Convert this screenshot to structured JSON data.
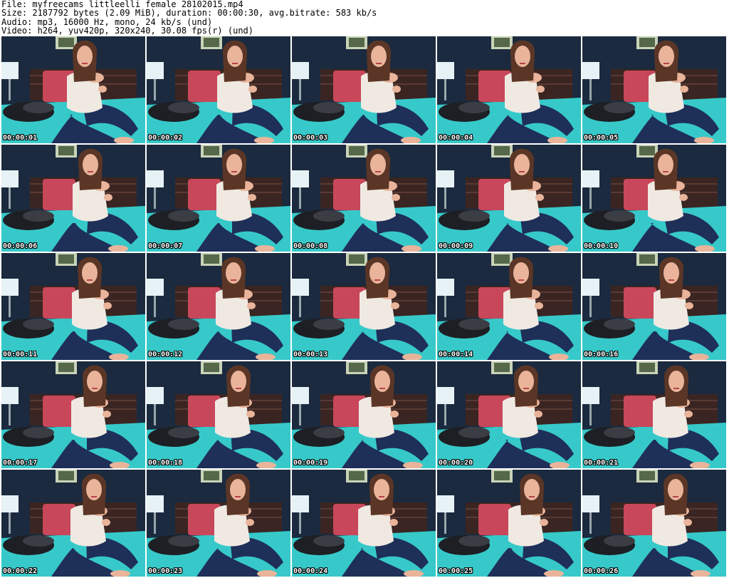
{
  "header": {
    "file_line": "File: myfreecams_littleelli_female_28102015.mp4",
    "size_line": "Size: 2187792 bytes (2.09 MiB), duration: 00:00:30, avg.bitrate: 583 kb/s",
    "audio_line": "Audio: mp3, 16000 Hz, mono, 24 kb/s (und)",
    "video_line": "Video: h264, yuv420p, 320x240, 30.08 fps(r) (und)"
  },
  "thumbnails": [
    {
      "timestamp": "00:00:01"
    },
    {
      "timestamp": "00:00:02"
    },
    {
      "timestamp": "00:00:03"
    },
    {
      "timestamp": "00:00:04"
    },
    {
      "timestamp": "00:00:05"
    },
    {
      "timestamp": "00:00:06"
    },
    {
      "timestamp": "00:00:07"
    },
    {
      "timestamp": "00:00:08"
    },
    {
      "timestamp": "00:00:09"
    },
    {
      "timestamp": "00:00:10"
    },
    {
      "timestamp": "00:00:11"
    },
    {
      "timestamp": "00:00:12"
    },
    {
      "timestamp": "00:00:13"
    },
    {
      "timestamp": "00:00:14"
    },
    {
      "timestamp": "00:00:16"
    },
    {
      "timestamp": "00:00:17"
    },
    {
      "timestamp": "00:00:18"
    },
    {
      "timestamp": "00:00:19"
    },
    {
      "timestamp": "00:00:20"
    },
    {
      "timestamp": "00:00:21"
    },
    {
      "timestamp": "00:00:22"
    },
    {
      "timestamp": "00:00:23"
    },
    {
      "timestamp": "00:00:24"
    },
    {
      "timestamp": "00:00:25"
    },
    {
      "timestamp": "00:00:26"
    }
  ],
  "colors": {
    "wall": "#1b2a3e",
    "bed": "#37c9c9",
    "pillow_red": "#c8475a",
    "pillow_black": "#1d1f24",
    "lamp": "#e6f2f6",
    "sweater": "#efe9e2",
    "jeans": "#1e2f58",
    "skin": "#e9b49a",
    "hair": "#5b3626",
    "headboard": "#3a2522",
    "frame": "#c9d3b8"
  }
}
